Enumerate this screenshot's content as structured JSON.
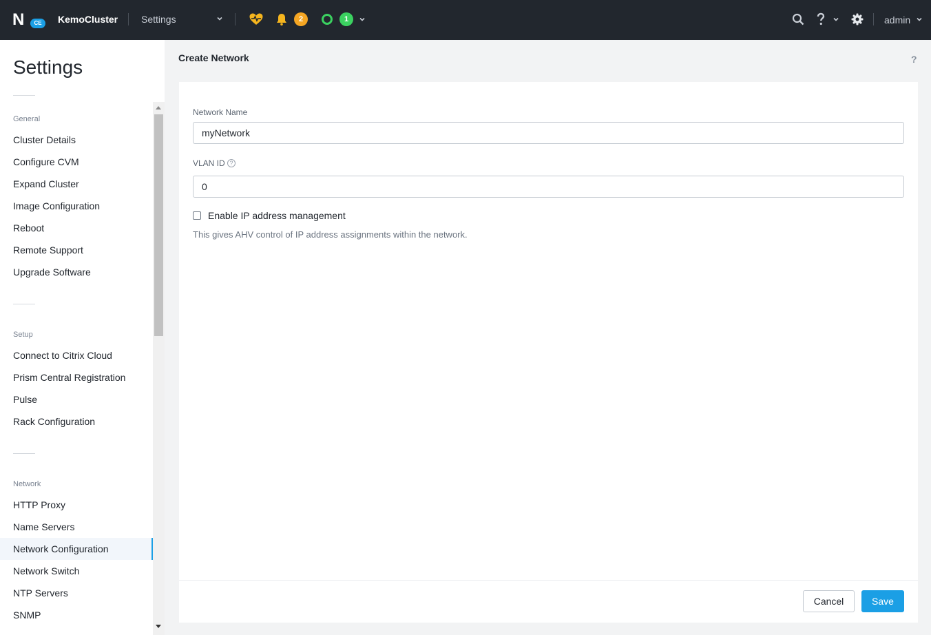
{
  "header": {
    "logo_badge": "CE",
    "cluster_name": "KemoCluster",
    "nav_label": "Settings",
    "alerts_count": "2",
    "tasks_count": "1",
    "user": "admin",
    "colors": {
      "bar": "#22272e",
      "health": "#f5b51e",
      "alerts": "#f5a623",
      "tasks": "#3bd160"
    }
  },
  "sidebar": {
    "title": "Settings",
    "sections": [
      {
        "title": "General",
        "items": [
          "Cluster Details",
          "Configure CVM",
          "Expand Cluster",
          "Image Configuration",
          "Reboot",
          "Remote Support",
          "Upgrade Software"
        ]
      },
      {
        "title": "Setup",
        "items": [
          "Connect to Citrix Cloud",
          "Prism Central Registration",
          "Pulse",
          "Rack Configuration"
        ]
      },
      {
        "title": "Network",
        "items": [
          "HTTP Proxy",
          "Name Servers",
          "Network Configuration",
          "Network Switch",
          "NTP Servers",
          "SNMP"
        ]
      }
    ],
    "active_item": "Network Configuration"
  },
  "main": {
    "title": "Create Network",
    "help": "?",
    "network_name_label": "Network Name",
    "network_name_value": "myNetwork",
    "vlan_label": "VLAN ID",
    "vlan_info": "?",
    "vlan_value": "0",
    "ipam_label": "Enable IP address management",
    "ipam_checked": false,
    "ipam_help": "This gives AHV control of IP address assignments within the network.",
    "cancel_label": "Cancel",
    "save_label": "Save",
    "accent": "#1b9fe5"
  }
}
